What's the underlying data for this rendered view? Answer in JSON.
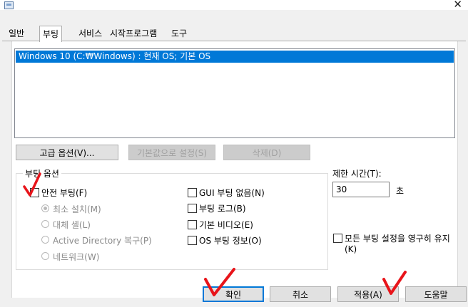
{
  "tabs": [
    {
      "label": "일반"
    },
    {
      "label": "부팅"
    },
    {
      "label": "서비스"
    },
    {
      "label": "시작프로그램"
    },
    {
      "label": "도구"
    }
  ],
  "os_list": {
    "entries": [
      "Windows 10 (C:₩Windows) : 현재 OS; 기본 OS"
    ]
  },
  "list_buttons": {
    "advanced": "고급 옵션(V)...",
    "set_default": "기본값으로 설정(S)",
    "delete": "삭제(D)"
  },
  "boot_options": {
    "group_label": "부팅 옵션",
    "safe_boot": "안전 부팅(F)",
    "minimal": "최소 설치(M)",
    "alternate_shell": "대체 셸(L)",
    "active_directory": "Active Directory 복구(P)",
    "network": "네트워크(W)",
    "no_gui": "GUI 부팅 없음(N)",
    "boot_log": "부팅 로그(B)",
    "base_video": "기본 비디오(E)",
    "os_info": "OS 부팅 정보(O)"
  },
  "timeout": {
    "label": "제한 시간(T):",
    "value": "30",
    "unit": "초"
  },
  "permanent": {
    "line1": "모든 부팅 설정을 영구히 유지",
    "line2": "(K)"
  },
  "footer_buttons": {
    "ok": "확인",
    "cancel": "취소",
    "apply": "적용(A)",
    "help": "도움말"
  },
  "colors": {
    "selection": "#0078d7",
    "annotation": "#e8141a"
  }
}
